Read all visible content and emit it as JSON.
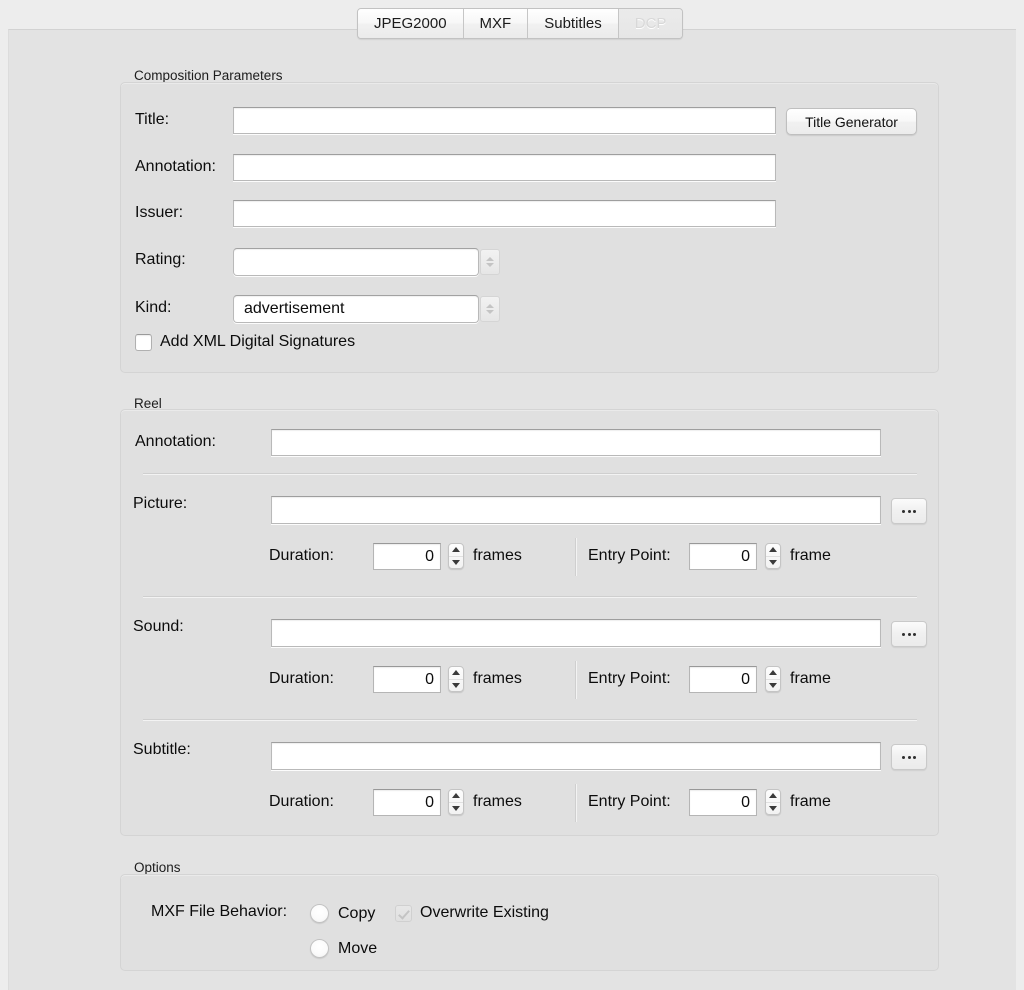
{
  "window": {
    "background_color": "#ededed",
    "panel_color": "#e3e3e3"
  },
  "tabs": [
    {
      "label": "JPEG2000",
      "state": "normal"
    },
    {
      "label": "MXF",
      "state": "normal"
    },
    {
      "label": "Subtitles",
      "state": "normal"
    },
    {
      "label": "DCP",
      "state": "disabled"
    }
  ],
  "composition": {
    "group_title": "Composition Parameters",
    "title_label": "Title:",
    "title_value": "",
    "title_generator_button": "Title Generator",
    "annotation_label": "Annotation:",
    "annotation_value": "",
    "issuer_label": "Issuer:",
    "issuer_value": "",
    "rating_label": "Rating:",
    "rating_value": "",
    "kind_label": "Kind:",
    "kind_value": "advertisement",
    "signatures_checkbox_label": "Add XML Digital Signatures",
    "signatures_checked": false
  },
  "reel": {
    "group_title": "Reel",
    "annotation_label": "Annotation:",
    "annotation_value": "",
    "rows": [
      {
        "label": "Picture:",
        "path_value": "",
        "browse_button": "...",
        "duration_label": "Duration:",
        "duration_value": "0",
        "duration_unit": "frames",
        "entry_label": "Entry Point:",
        "entry_value": "0",
        "entry_unit": "frame"
      },
      {
        "label": "Sound:",
        "path_value": "",
        "browse_button": "...",
        "duration_label": "Duration:",
        "duration_value": "0",
        "duration_unit": "frames",
        "entry_label": "Entry Point:",
        "entry_value": "0",
        "entry_unit": "frame"
      },
      {
        "label": "Subtitle:",
        "path_value": "",
        "browse_button": "...",
        "duration_label": "Duration:",
        "duration_value": "0",
        "duration_unit": "frames",
        "entry_label": "Entry Point:",
        "entry_value": "0",
        "entry_unit": "frame"
      }
    ]
  },
  "options": {
    "group_title": "Options",
    "mxf_behavior_label": "MXF File Behavior:",
    "radio_copy_label": "Copy",
    "radio_copy_selected": false,
    "radio_move_label": "Move",
    "radio_move_selected": false,
    "overwrite_label": "Overwrite Existing",
    "overwrite_checked": true,
    "overwrite_enabled": false
  }
}
